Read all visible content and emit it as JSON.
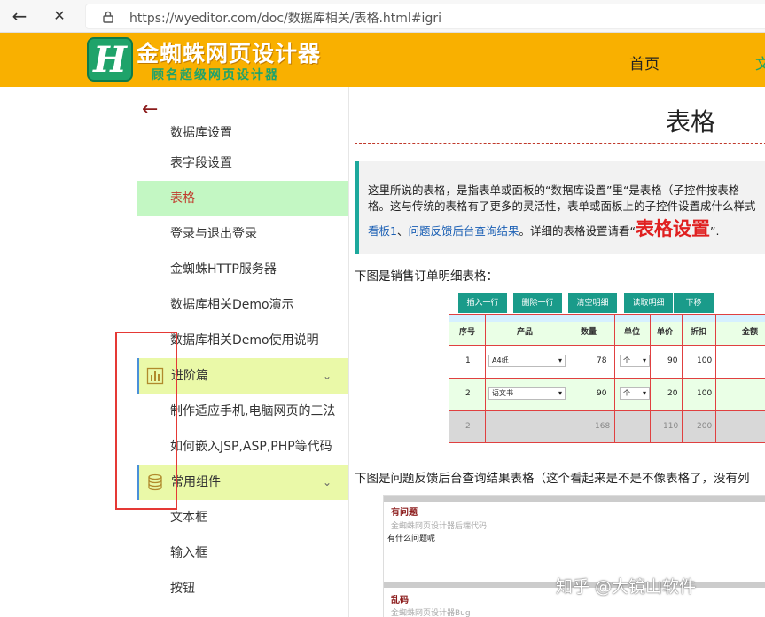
{
  "browser": {
    "url": "https://wyeditor.com/doc/数据库相关/表格.html#igri",
    "back_icon": "←",
    "close_icon": "✕"
  },
  "header": {
    "logo_letter": "H",
    "logo_title": "金蜘蛛网页设计器",
    "logo_subtitle": "顾名超级网页设计器",
    "nav": [
      "首页",
      "文"
    ]
  },
  "sidebar": {
    "back_icon": "←",
    "cut_item": "数据库设置",
    "items": [
      {
        "label": "表字段设置"
      },
      {
        "label": "表格"
      },
      {
        "label": "登录与退出登录"
      },
      {
        "label": "金蜘蛛HTTP服务器"
      },
      {
        "label": "数据库相关Demo演示"
      },
      {
        "label": "数据库相关Demo使用说明"
      }
    ],
    "group1": {
      "label": "进阶篇",
      "icon": "bar-chart-icon"
    },
    "group1_items": [
      {
        "label": "制作适应手机,电脑网页的三法"
      },
      {
        "label": "如何嵌入JSP,ASP,PHP等代码"
      }
    ],
    "group2": {
      "label": "常用组件",
      "icon": "database-icon"
    },
    "group2_items": [
      {
        "label": "文本框"
      },
      {
        "label": "输入框"
      },
      {
        "label": "按钮"
      }
    ]
  },
  "content": {
    "title": "表格",
    "notice_line1": "这里所说的表格，是指表单或面板的“数据库设置”里“是表格（子控件按表格",
    "notice_line2": "格。这与传统的表格有了更多的灵活性，表单或面板上的子控件设置成什么样式",
    "notice_link1": "看板1",
    "notice_sep": "、",
    "notice_link2": "问题反馈后台查询结果",
    "notice_text3": "。详细的表格设置请看“",
    "notice_big": "表格设置",
    "notice_end": "”.",
    "para1": "下图是销售订单明细表格：",
    "para2": "下图是问题反馈后台查询结果表格（这个看起来是不是不像表格了，没有列"
  },
  "sales_table": {
    "buttons": [
      "插入一行",
      "删除一行",
      "清空明细",
      "读取明细",
      "下移"
    ],
    "headers": [
      "序号",
      "产品",
      "数量",
      "单位",
      "单价",
      "折扣",
      "金额"
    ],
    "rows": [
      {
        "no": "1",
        "product": "A4纸",
        "qty": "78",
        "unit": "个",
        "price": "90",
        "discount": "100"
      },
      {
        "no": "2",
        "product": "语文书",
        "qty": "90",
        "unit": "个",
        "price": "20",
        "discount": "100"
      }
    ],
    "total": {
      "no": "2",
      "qty": "168",
      "price": "110",
      "discount": "200"
    }
  },
  "feedback": {
    "item1_title": "有问题",
    "item1_sub": "金蜘蛛网页设计器后端代码",
    "item1_text": "有什么问题呢",
    "item2_title": "乱码",
    "item2_sub": "金蜘蛛网页设计器Bug"
  },
  "watermark": "知乎 @大镜山软件"
}
